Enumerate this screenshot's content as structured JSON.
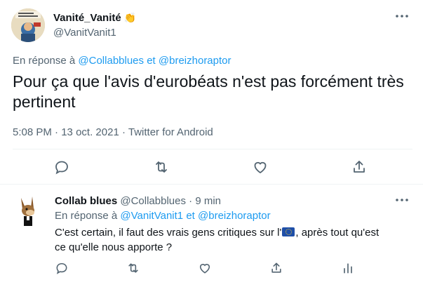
{
  "tweet": {
    "author_name": "Vanité_Vanité",
    "author_emoji": "👏",
    "author_handle": "@VanitVanit1",
    "reply_prefix": "En réponse à",
    "reply_user1": "@Collabblues",
    "reply_conj": "et",
    "reply_user2": "@breizhoraptor",
    "text": "Pour ça que l'avis d'eurobéats n'est pas forcément très pertinent",
    "time": "5:08 PM",
    "date": "13 oct. 2021",
    "source": "Twitter for Android",
    "dot": "·"
  },
  "reply": {
    "author_name": "Collab blues",
    "author_handle": "@Collabblues",
    "dot": "·",
    "time_ago": "9 min",
    "reply_prefix": "En réponse à",
    "reply_user1": "@VanitVanit1",
    "reply_conj": "et",
    "reply_user2": "@breizhoraptor",
    "text_before_flag": "C'est certain, il faut des vrais gens critiques sur l'",
    "text_after_flag": ", après tout qu'est ce qu'elle nous apporte ?"
  },
  "icons": {
    "reply": "reply-icon",
    "retweet": "retweet-icon",
    "like": "heart-icon",
    "share": "share-icon",
    "analytics": "analytics-icon",
    "more": "more-icon",
    "flag": "eu-flag-icon"
  },
  "colors": {
    "accent": "#1d9bf0",
    "muted": "#536471",
    "divider": "#eff3f4"
  }
}
